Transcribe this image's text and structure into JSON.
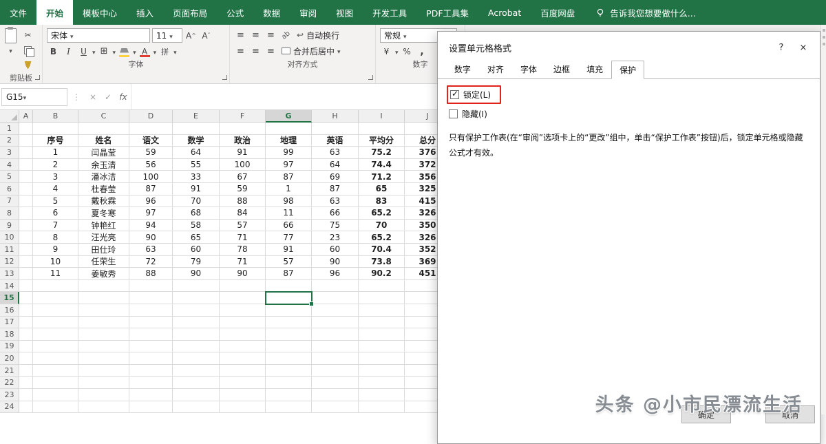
{
  "colors": {
    "brand_green": "#217346",
    "highlight_red": "#e0231a",
    "selected_header": "#d6d6d6"
  },
  "ribbon": {
    "tabs": [
      {
        "label": "文件",
        "active": false
      },
      {
        "label": "开始",
        "active": true
      },
      {
        "label": "模板中心",
        "active": false
      },
      {
        "label": "插入",
        "active": false
      },
      {
        "label": "页面布局",
        "active": false
      },
      {
        "label": "公式",
        "active": false
      },
      {
        "label": "数据",
        "active": false
      },
      {
        "label": "审阅",
        "active": false
      },
      {
        "label": "视图",
        "active": false
      },
      {
        "label": "开发工具",
        "active": false
      },
      {
        "label": "PDF工具集",
        "active": false
      },
      {
        "label": "Acrobat",
        "active": false
      },
      {
        "label": "百度网盘",
        "active": false
      }
    ],
    "search_text": "告诉我您想要做什么...",
    "font_name": "宋体",
    "font_size": "11",
    "number_format": "常规",
    "wrap_label": "自动换行",
    "merge_label": "合并后居中",
    "group_labels": [
      "剪贴板",
      "字体",
      "对齐方式",
      "数字"
    ]
  },
  "formula_bar": {
    "name_box": "G15",
    "cancel": "×",
    "enter": "✓",
    "fx": "fx"
  },
  "sheet": {
    "columns": [
      "A",
      "B",
      "C",
      "D",
      "E",
      "F",
      "G",
      "H",
      "I",
      "J"
    ],
    "selected_cell": "G15",
    "selected_column": "G",
    "selected_row": 15,
    "num_rows": 24,
    "header_row": 2,
    "headers": [
      "序号",
      "姓名",
      "语文",
      "数学",
      "政治",
      "地理",
      "英语",
      "平均分",
      "总分"
    ],
    "data_start_row": 3,
    "rows": [
      [
        "1",
        "闫晶莹",
        "59",
        "64",
        "91",
        "99",
        "63",
        "75.2",
        "376"
      ],
      [
        "2",
        "余玉清",
        "56",
        "55",
        "100",
        "97",
        "64",
        "74.4",
        "372"
      ],
      [
        "3",
        "潘冰洁",
        "100",
        "33",
        "67",
        "87",
        "69",
        "71.2",
        "356"
      ],
      [
        "4",
        "杜春莹",
        "87",
        "91",
        "59",
        "1",
        "87",
        "65",
        "325"
      ],
      [
        "5",
        "戴秋霖",
        "96",
        "70",
        "88",
        "98",
        "63",
        "83",
        "415"
      ],
      [
        "6",
        "夏冬寒",
        "97",
        "68",
        "84",
        "11",
        "66",
        "65.2",
        "326"
      ],
      [
        "7",
        "钟艳红",
        "94",
        "58",
        "57",
        "66",
        "75",
        "70",
        "350"
      ],
      [
        "8",
        "汪光亮",
        "90",
        "65",
        "71",
        "77",
        "23",
        "65.2",
        "326"
      ],
      [
        "9",
        "田仕玲",
        "63",
        "60",
        "78",
        "91",
        "60",
        "70.4",
        "352"
      ],
      [
        "10",
        "任荣生",
        "72",
        "79",
        "71",
        "57",
        "90",
        "73.8",
        "369"
      ],
      [
        "11",
        "姜敏秀",
        "88",
        "90",
        "90",
        "87",
        "96",
        "90.2",
        "451"
      ]
    ]
  },
  "dialog": {
    "title": "设置单元格格式",
    "help_label": "?",
    "close_label": "×",
    "tabs": [
      "数字",
      "对齐",
      "字体",
      "边框",
      "填充",
      "保护"
    ],
    "active_tab": "保护",
    "checkboxes": [
      {
        "key": "lock",
        "label": "锁定(L)",
        "checked": true,
        "highlighted": true
      },
      {
        "key": "hide",
        "label": "隐藏(I)",
        "checked": false,
        "highlighted": false
      }
    ],
    "description": "只有保护工作表(在“审阅”选项卡上的“更改”组中，单击“保护工作表”按钮)后，锁定单元格或隐藏公式才有效。",
    "ok_label": "确定",
    "cancel_label": "取消"
  },
  "watermark": "头条 @小市民漂流生活"
}
